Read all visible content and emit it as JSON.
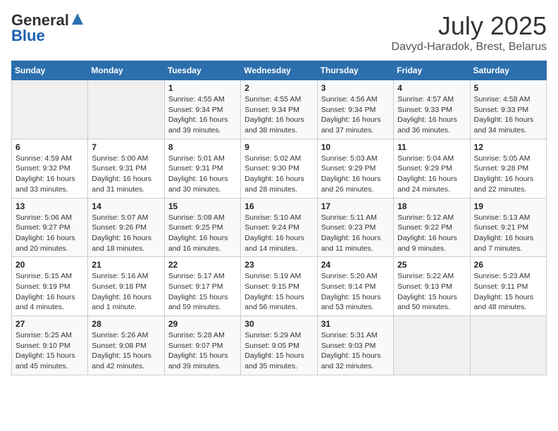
{
  "header": {
    "logo_general": "General",
    "logo_blue": "Blue",
    "title": "July 2025",
    "subtitle": "Davyd-Haradok, Brest, Belarus"
  },
  "calendar": {
    "days_of_week": [
      "Sunday",
      "Monday",
      "Tuesday",
      "Wednesday",
      "Thursday",
      "Friday",
      "Saturday"
    ],
    "weeks": [
      [
        {
          "day": "",
          "info": ""
        },
        {
          "day": "",
          "info": ""
        },
        {
          "day": "1",
          "info": "Sunrise: 4:55 AM\nSunset: 9:34 PM\nDaylight: 16 hours and 39 minutes."
        },
        {
          "day": "2",
          "info": "Sunrise: 4:55 AM\nSunset: 9:34 PM\nDaylight: 16 hours and 38 minutes."
        },
        {
          "day": "3",
          "info": "Sunrise: 4:56 AM\nSunset: 9:34 PM\nDaylight: 16 hours and 37 minutes."
        },
        {
          "day": "4",
          "info": "Sunrise: 4:57 AM\nSunset: 9:33 PM\nDaylight: 16 hours and 36 minutes."
        },
        {
          "day": "5",
          "info": "Sunrise: 4:58 AM\nSunset: 9:33 PM\nDaylight: 16 hours and 34 minutes."
        }
      ],
      [
        {
          "day": "6",
          "info": "Sunrise: 4:59 AM\nSunset: 9:32 PM\nDaylight: 16 hours and 33 minutes."
        },
        {
          "day": "7",
          "info": "Sunrise: 5:00 AM\nSunset: 9:31 PM\nDaylight: 16 hours and 31 minutes."
        },
        {
          "day": "8",
          "info": "Sunrise: 5:01 AM\nSunset: 9:31 PM\nDaylight: 16 hours and 30 minutes."
        },
        {
          "day": "9",
          "info": "Sunrise: 5:02 AM\nSunset: 9:30 PM\nDaylight: 16 hours and 28 minutes."
        },
        {
          "day": "10",
          "info": "Sunrise: 5:03 AM\nSunset: 9:29 PM\nDaylight: 16 hours and 26 minutes."
        },
        {
          "day": "11",
          "info": "Sunrise: 5:04 AM\nSunset: 9:29 PM\nDaylight: 16 hours and 24 minutes."
        },
        {
          "day": "12",
          "info": "Sunrise: 5:05 AM\nSunset: 9:28 PM\nDaylight: 16 hours and 22 minutes."
        }
      ],
      [
        {
          "day": "13",
          "info": "Sunrise: 5:06 AM\nSunset: 9:27 PM\nDaylight: 16 hours and 20 minutes."
        },
        {
          "day": "14",
          "info": "Sunrise: 5:07 AM\nSunset: 9:26 PM\nDaylight: 16 hours and 18 minutes."
        },
        {
          "day": "15",
          "info": "Sunrise: 5:08 AM\nSunset: 9:25 PM\nDaylight: 16 hours and 16 minutes."
        },
        {
          "day": "16",
          "info": "Sunrise: 5:10 AM\nSunset: 9:24 PM\nDaylight: 16 hours and 14 minutes."
        },
        {
          "day": "17",
          "info": "Sunrise: 5:11 AM\nSunset: 9:23 PM\nDaylight: 16 hours and 11 minutes."
        },
        {
          "day": "18",
          "info": "Sunrise: 5:12 AM\nSunset: 9:22 PM\nDaylight: 16 hours and 9 minutes."
        },
        {
          "day": "19",
          "info": "Sunrise: 5:13 AM\nSunset: 9:21 PM\nDaylight: 16 hours and 7 minutes."
        }
      ],
      [
        {
          "day": "20",
          "info": "Sunrise: 5:15 AM\nSunset: 9:19 PM\nDaylight: 16 hours and 4 minutes."
        },
        {
          "day": "21",
          "info": "Sunrise: 5:16 AM\nSunset: 9:18 PM\nDaylight: 16 hours and 1 minute."
        },
        {
          "day": "22",
          "info": "Sunrise: 5:17 AM\nSunset: 9:17 PM\nDaylight: 15 hours and 59 minutes."
        },
        {
          "day": "23",
          "info": "Sunrise: 5:19 AM\nSunset: 9:15 PM\nDaylight: 15 hours and 56 minutes."
        },
        {
          "day": "24",
          "info": "Sunrise: 5:20 AM\nSunset: 9:14 PM\nDaylight: 15 hours and 53 minutes."
        },
        {
          "day": "25",
          "info": "Sunrise: 5:22 AM\nSunset: 9:13 PM\nDaylight: 15 hours and 50 minutes."
        },
        {
          "day": "26",
          "info": "Sunrise: 5:23 AM\nSunset: 9:11 PM\nDaylight: 15 hours and 48 minutes."
        }
      ],
      [
        {
          "day": "27",
          "info": "Sunrise: 5:25 AM\nSunset: 9:10 PM\nDaylight: 15 hours and 45 minutes."
        },
        {
          "day": "28",
          "info": "Sunrise: 5:26 AM\nSunset: 9:08 PM\nDaylight: 15 hours and 42 minutes."
        },
        {
          "day": "29",
          "info": "Sunrise: 5:28 AM\nSunset: 9:07 PM\nDaylight: 15 hours and 39 minutes."
        },
        {
          "day": "30",
          "info": "Sunrise: 5:29 AM\nSunset: 9:05 PM\nDaylight: 15 hours and 35 minutes."
        },
        {
          "day": "31",
          "info": "Sunrise: 5:31 AM\nSunset: 9:03 PM\nDaylight: 15 hours and 32 minutes."
        },
        {
          "day": "",
          "info": ""
        },
        {
          "day": "",
          "info": ""
        }
      ]
    ]
  }
}
